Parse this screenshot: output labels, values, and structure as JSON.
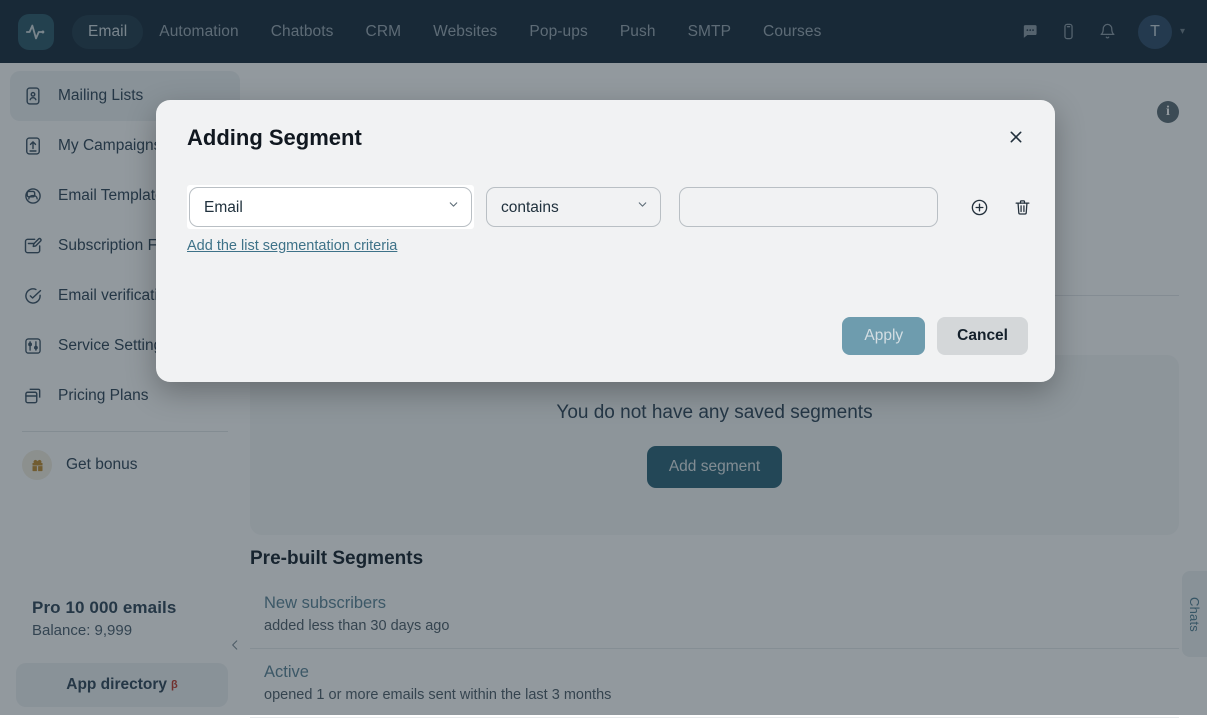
{
  "navbar": {
    "logo_icon": "pulse-logo-icon",
    "links": [
      {
        "label": "Email",
        "active": true
      },
      {
        "label": "Automation",
        "active": false
      },
      {
        "label": "Chatbots",
        "active": false
      },
      {
        "label": "CRM",
        "active": false
      },
      {
        "label": "Websites",
        "active": false
      },
      {
        "label": "Pop-ups",
        "active": false
      },
      {
        "label": "Push",
        "active": false
      },
      {
        "label": "SMTP",
        "active": false
      },
      {
        "label": "Courses",
        "active": false
      }
    ],
    "icons": [
      "chat-bubble-icon",
      "mobile-device-icon",
      "bell-icon"
    ],
    "avatar_initial": "T",
    "avatar_caret": "▾"
  },
  "sidebar": {
    "items": [
      {
        "label": "Mailing Lists",
        "icon": "contact-card-icon",
        "active": true
      },
      {
        "label": "My Campaigns",
        "icon": "upload-box-icon",
        "active": false
      },
      {
        "label": "Email Templates",
        "icon": "template-icon",
        "active": false
      },
      {
        "label": "Subscription Forms",
        "icon": "form-edit-icon",
        "active": false
      },
      {
        "label": "Email verification",
        "icon": "check-circle-icon",
        "active": false
      },
      {
        "label": "Service Settings",
        "icon": "sliders-icon",
        "active": false
      },
      {
        "label": "Pricing Plans",
        "icon": "cards-stack-icon",
        "active": false
      }
    ],
    "bonus": {
      "label": "Get bonus",
      "icon": "gift-icon"
    },
    "plan_title": "Pro 10 000 emails",
    "plan_balance": "Balance: 9,999",
    "app_directory_label": "App directory",
    "app_directory_badge": "β",
    "collapse_icon": "chevron-left-icon"
  },
  "main": {
    "info_icon": "info-icon",
    "info_glyph": "i",
    "empty_state": {
      "text": "You do not have any saved segments",
      "button_label": "Add segment"
    },
    "prebuilt_title": "Pre-built Segments",
    "prebuilt_rows": [
      {
        "name": "New subscribers",
        "desc": "added less than 30 days ago"
      },
      {
        "name": "Active",
        "desc": "opened 1 or more emails sent within the last 3 months"
      }
    ],
    "chats_tab_label": "Chats"
  },
  "modal": {
    "title": "Adding Segment",
    "close_icon": "close-icon",
    "field_select": {
      "value": "Email",
      "options": [
        "Email"
      ]
    },
    "operator_select": {
      "value": "contains",
      "options": [
        "contains"
      ]
    },
    "value_input": {
      "value": "",
      "placeholder": ""
    },
    "add_row_icon": "plus-circle-icon",
    "delete_row_icon": "trash-icon",
    "add_criteria_link": "Add the list segmentation criteria",
    "apply_label": "Apply",
    "cancel_label": "Cancel"
  },
  "colors": {
    "navbar_bg": "#16293a",
    "accent_teal": "#2b6377",
    "link_blue": "#3e7288",
    "apply_disabled": "#6e9cae",
    "modal_bg": "#f1f2f3"
  }
}
